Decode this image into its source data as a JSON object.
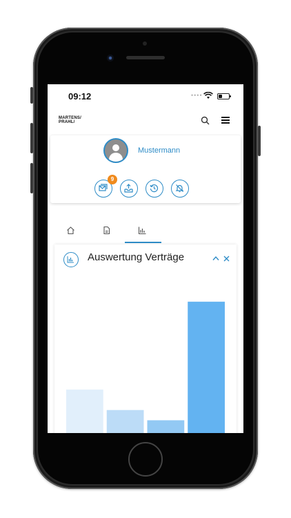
{
  "status": {
    "time": "09:12"
  },
  "brand": {
    "logo_line1": "MARTENS/",
    "logo_line2": "PRAHL/"
  },
  "profile": {
    "name": "Mustermann",
    "messages_badge": "9"
  },
  "actions": [
    {
      "icon": "message-icon"
    },
    {
      "icon": "inbox-upload-icon"
    },
    {
      "icon": "history-icon"
    },
    {
      "icon": "notifications-off-icon"
    }
  ],
  "tabs": [
    {
      "icon": "home-icon",
      "active": false
    },
    {
      "icon": "document-icon",
      "active": false
    },
    {
      "icon": "bar-chart-icon",
      "active": true
    }
  ],
  "panel": {
    "title": "Auswertung Verträge"
  },
  "colors": {
    "accent": "#2e8cc7",
    "badge": "#f08a1c"
  },
  "chart_data": {
    "type": "bar",
    "title": "Auswertung Verträge",
    "categories": [
      "",
      "",
      "",
      ""
    ],
    "values": [
      27,
      17,
      12,
      70
    ],
    "ylim": [
      0,
      75
    ],
    "colors": [
      "#e1effb",
      "#bcdcf7",
      "#93c9f4",
      "#63b3f1"
    ],
    "grid": false
  }
}
